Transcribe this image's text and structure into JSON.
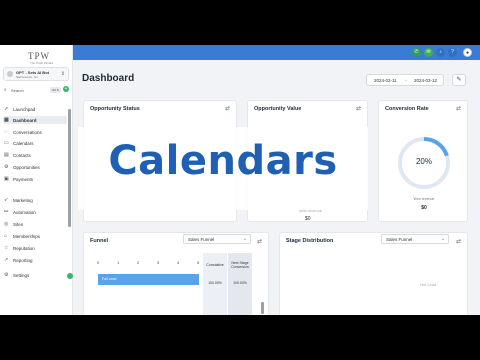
{
  "sidebar": {
    "logo": "TPW",
    "logo_sub": "The Profit Wizard",
    "account_name": "GPT - Sets AI Bot",
    "account_location": "Sacramento, NJ",
    "search_label": "Search",
    "search_shortcut": "ctrl K",
    "items": [
      {
        "label": "Launchpad",
        "icon": "rocket-icon"
      },
      {
        "label": "Dashboard",
        "icon": "dashboard-icon",
        "active": true
      },
      {
        "label": "Conversations",
        "icon": "chat-icon"
      },
      {
        "label": "Calendars",
        "icon": "calendar-icon"
      },
      {
        "label": "Contacts",
        "icon": "contacts-icon"
      },
      {
        "label": "Opportunities",
        "icon": "opportunities-icon"
      },
      {
        "label": "Payments",
        "icon": "payments-icon"
      },
      {
        "label": "Marketing",
        "icon": "marketing-icon"
      },
      {
        "label": "Automation",
        "icon": "automation-icon"
      },
      {
        "label": "Sites",
        "icon": "sites-icon"
      },
      {
        "label": "Memberships",
        "icon": "memberships-icon"
      },
      {
        "label": "Reputation",
        "icon": "reputation-icon"
      },
      {
        "label": "Reporting",
        "icon": "reporting-icon"
      }
    ],
    "settings_label": "Settings"
  },
  "topbar": {
    "accent": "#3a7bd5",
    "icons": [
      {
        "name": "phone-icon",
        "color": "#2e9e5b"
      },
      {
        "name": "megaphone-icon",
        "color": "#3fae4f"
      },
      {
        "name": "bell-icon",
        "color": "#2f6fc4"
      },
      {
        "name": "help-icon",
        "color": "#2f6fc4"
      },
      {
        "name": "avatar",
        "color": "#ffffff"
      }
    ]
  },
  "main": {
    "title": "Dashboard",
    "date_start": "2024-02-11",
    "date_end": "2024-03-12",
    "cards": {
      "opportunity_status": {
        "title": "Opportunity Status"
      },
      "opportunity_value": {
        "title": "Opportunity Value",
        "faint_label": "Total revenue",
        "faint_value": "$0"
      },
      "conversion_rate": {
        "title": "Conversion Rate",
        "percent": "20%",
        "sub_label": "Won revenue",
        "sub_value": "$0"
      },
      "funnel": {
        "title": "Funnel",
        "select": "Sales Funnel",
        "axis": [
          "0",
          "1",
          "2",
          "3",
          "4",
          "5"
        ],
        "bar_label": "Fall Lead",
        "cumulative_header": "Cumulative",
        "next_stage_header": "Next Stage Conversion",
        "cumulative_value": "100.00%",
        "next_stage_value": "100.00%"
      },
      "stage_distribution": {
        "title": "Stage Distribution",
        "select": "Sales Funnel",
        "faint": "Hot Lead"
      }
    }
  },
  "overlay": {
    "text": "Calendars"
  }
}
